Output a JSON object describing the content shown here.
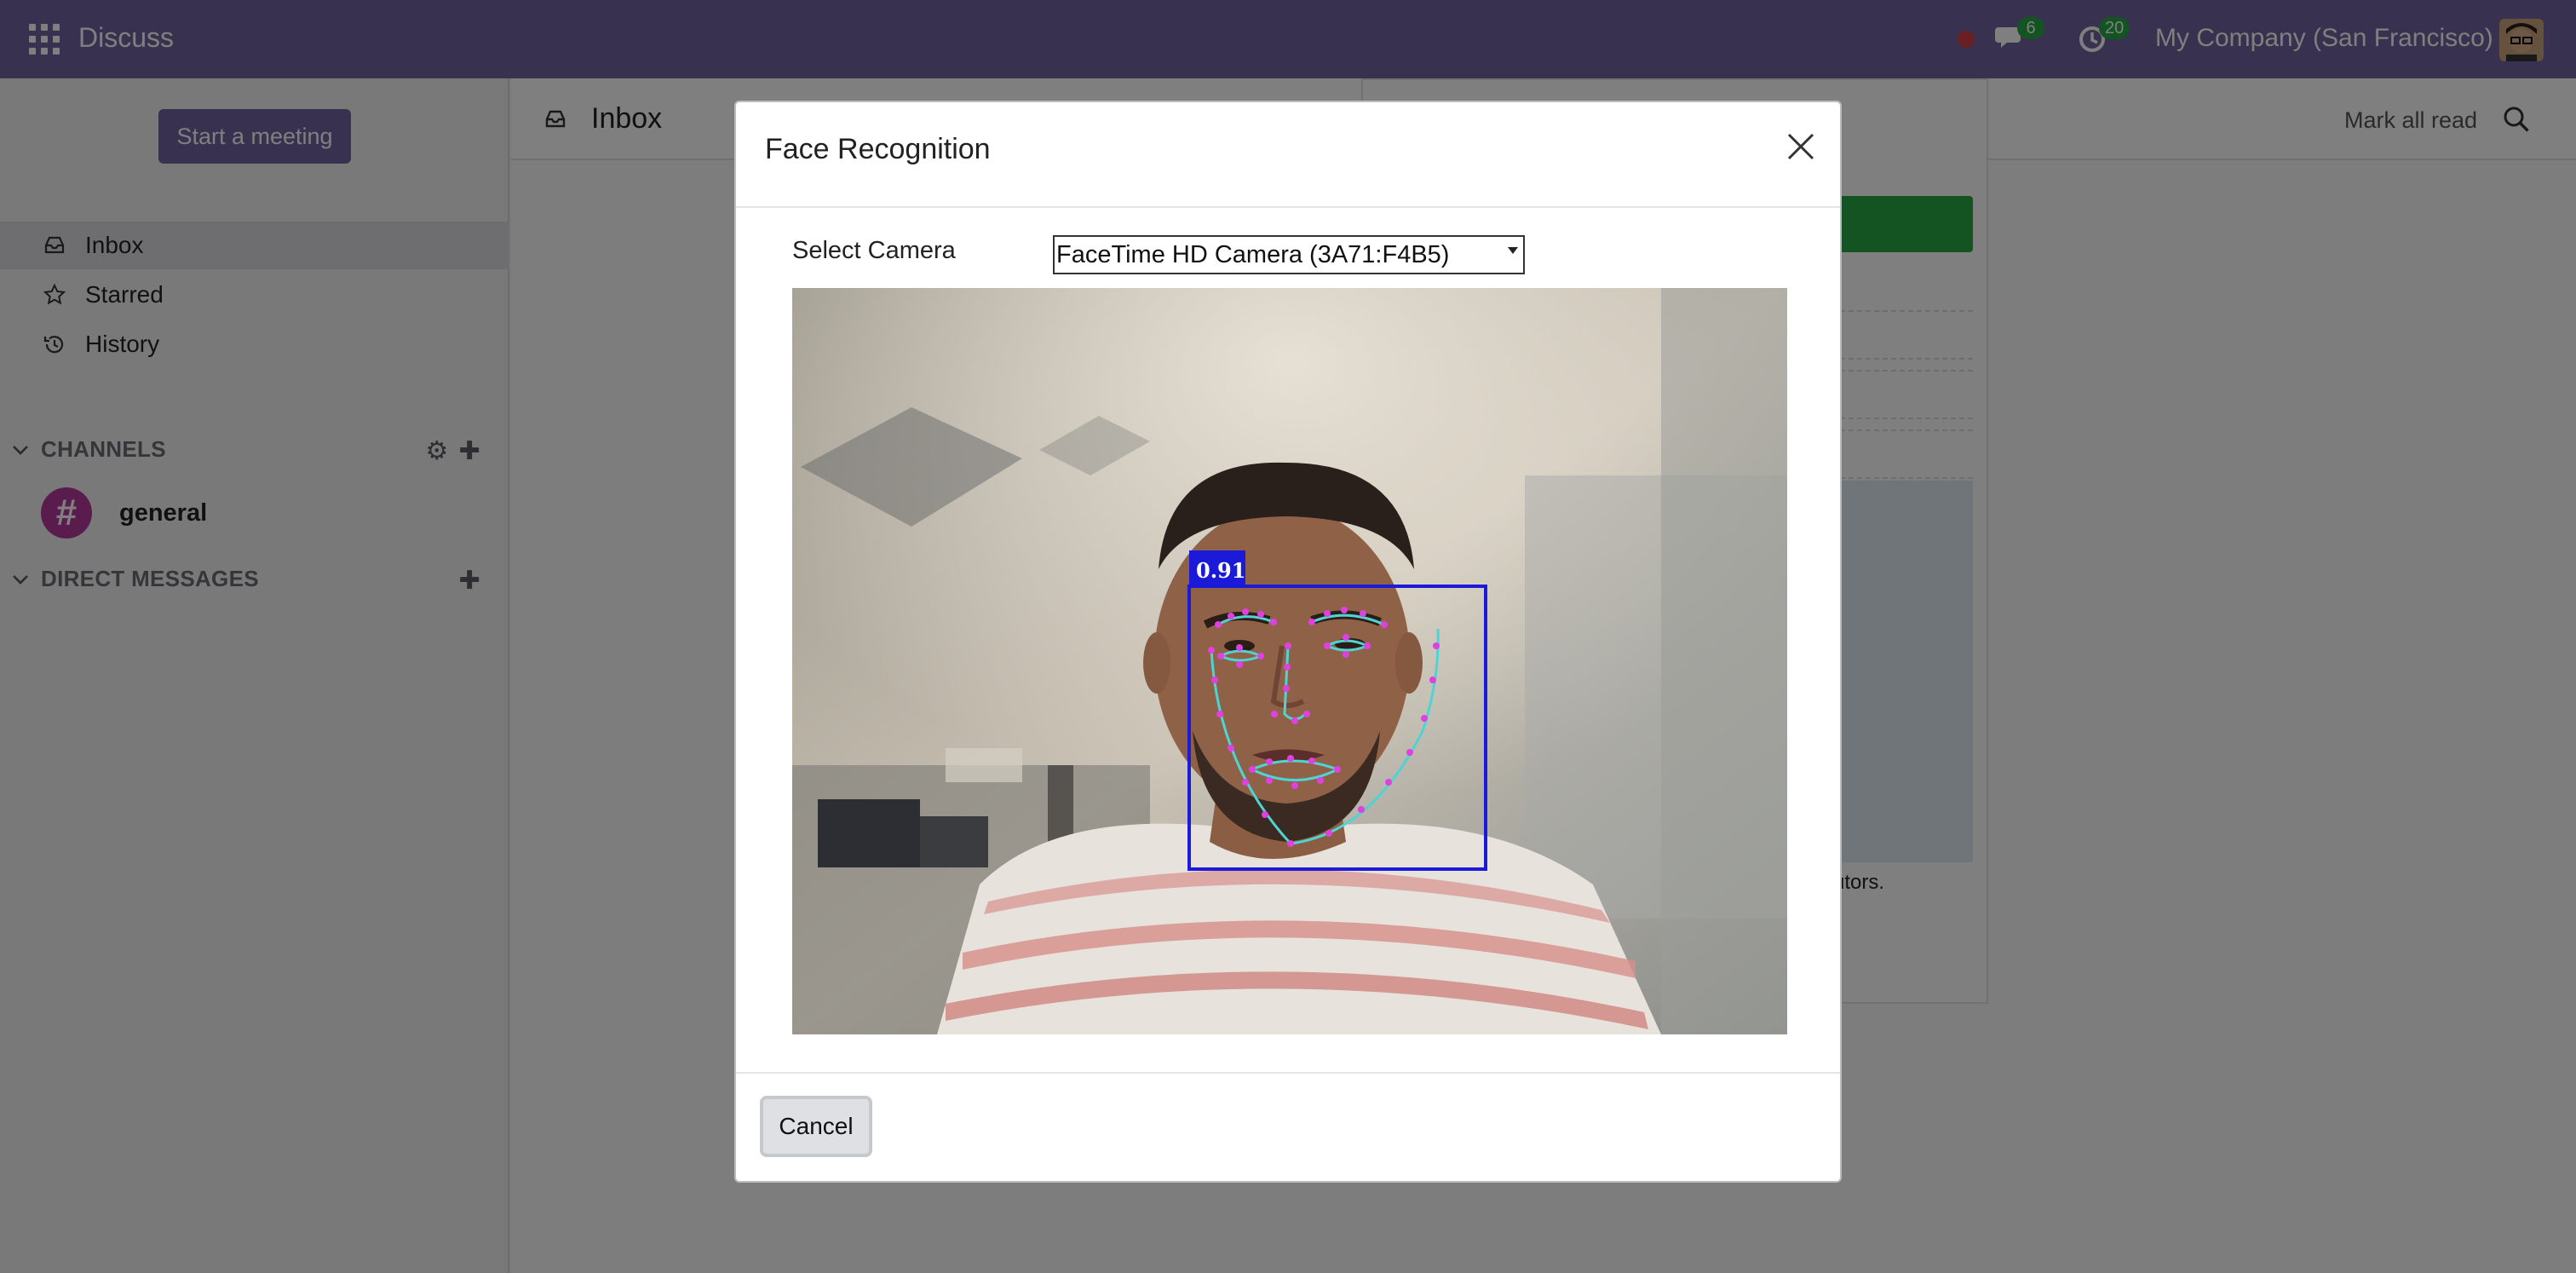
{
  "navbar": {
    "app_name": "Discuss",
    "messages_count": "6",
    "activities_count": "20",
    "company": "My Company (San Francisco)"
  },
  "sidebar": {
    "start_meeting": "Start a meeting",
    "items": [
      {
        "label": "Inbox",
        "icon": "inbox-icon",
        "active": true
      },
      {
        "label": "Starred",
        "icon": "star-icon",
        "active": false
      },
      {
        "label": "History",
        "icon": "history-icon",
        "active": false
      }
    ],
    "channels_header": "CHANNELS",
    "channels": [
      {
        "name": "general"
      }
    ],
    "direct_messages_header": "DIRECT MESSAGES"
  },
  "main": {
    "title": "Inbox",
    "mark_all_read": "Mark all read",
    "background_text": "contributors."
  },
  "modal": {
    "title": "Face Recognition",
    "select_camera_label": "Select Camera",
    "camera_selected": "FaceTime HD Camera (3A71:F4B5)",
    "detection_score": "0.91",
    "cancel_label": "Cancel"
  },
  "colors": {
    "navbar": "#71639e",
    "badge": "#28a745",
    "channel_avatar": "#b5389a",
    "face_box": "#1a1ad8",
    "landmark_points": "#e040e0",
    "landmark_lines": "#4fd3d3"
  }
}
